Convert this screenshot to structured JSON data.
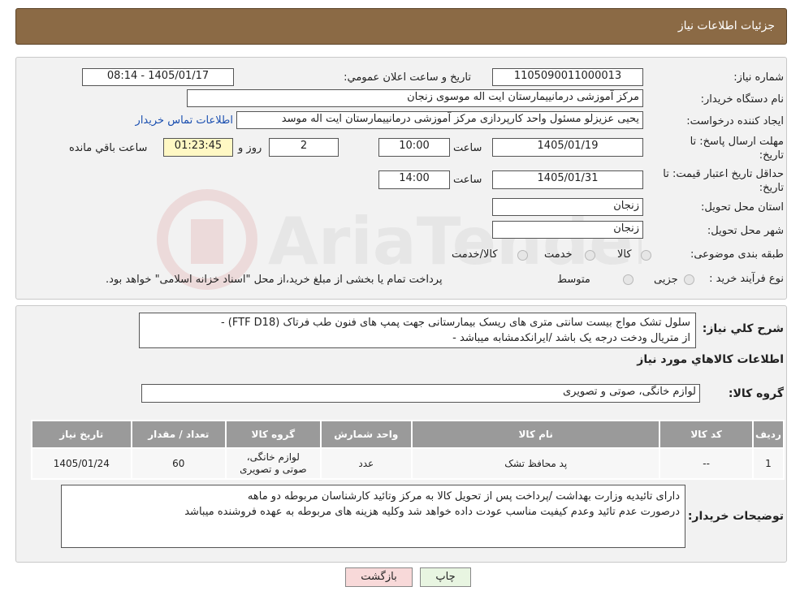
{
  "header": {
    "title": "جزئیات اطلاعات نیاز"
  },
  "form": {
    "need_number_label": "شماره نیاز:",
    "need_number": "1105090011000013",
    "announce_label": "تاریخ و ساعت اعلان عمومي:",
    "announce_value": "1405/01/17 - 08:14",
    "buyer_label": "نام دستگاه خريدار:",
    "buyer_value": "مرکز آموزشی درمانییمارستان ایت اله موسوی زنجان",
    "creator_label": "ايجاد کننده درخواست:",
    "creator_value": "یحیی عزیزلو مسئول واحد کارپردازی مرکز آموزشی درمانییمارستان ایت اله موسد",
    "contact_link": "اطلاعات تماس خريدار",
    "reply_deadline_label": "مهلت ارسال پاسخ: تا تاريخ:",
    "reply_date": "1405/01/19",
    "time_label": "ساعت",
    "reply_time": "10:00",
    "days_value": "2",
    "days_label": "روز و",
    "remaining_time": "01:23:45",
    "remaining_label": "ساعت باقي مانده",
    "validity_label": "حداقل تاريخ اعتبار قيمت: تا تاريخ:",
    "validity_date": "1405/01/31",
    "validity_time": "14:00",
    "province_label": "استان محل تحويل:",
    "province_value": "زنجان",
    "city_label": "شهر محل تحويل:",
    "city_value": "زنجان",
    "category_label": "طبقه بندی موضوعی:",
    "category_options": [
      "کالا",
      "خدمت",
      "کالا/خدمت"
    ],
    "process_label": "نوع فرآيند خريد :",
    "process_options": [
      "جزیی",
      "متوسط"
    ],
    "process_note": "پرداخت تمام یا بخشی از مبلغ خرید،از محل \"اسناد خزانه اسلامی\" خواهد بود."
  },
  "summary": {
    "label": "شرح کلي نياز:",
    "text_line1": "سلول تشک مواج بیست سانتی متری های ریسک بیمارستانی جهت پمپ های فنون طب فرتاک (FTF  D18) -",
    "text_line2": "از متریال  ودخت درجه یک باشد /ایرانکدمشابه میباشد -"
  },
  "goods": {
    "section_title": "اطلاعات کالاهاي مورد نياز",
    "group_label": "گروه کالا:",
    "group_value": "لوازم خانگی، صوتی و تصویری",
    "columns": [
      "رديف",
      "کد کالا",
      "نام کالا",
      "واحد شمارش",
      "گروه کالا",
      "تعداد / مقدار",
      "تاريخ نياز"
    ],
    "rows": [
      {
        "row": "1",
        "code": "--",
        "name": "پد محافظ تشک",
        "unit": "عدد",
        "group_l1": "لوازم خانگی،",
        "group_l2": "صوتی و تصویری",
        "qty": "60",
        "date": "1405/01/24"
      }
    ]
  },
  "buyer_notes": {
    "label": "توضيحات خريدار:",
    "line1": "دارای تائیدیه وزارت بهداشت /پرداخت پس از تحویل کالا به مرکز وتائید کارشناسان مربوطه دو ماهه",
    "line2": "درصورت عدم تائید وعدم کیفیت مناسب عودت داده خواهد شد وکلیه هزینه های مربوطه به عهده فروشنده میباشد"
  },
  "buttons": {
    "print": "چاپ",
    "back": "بازگشت"
  },
  "watermark": {
    "text": "AriaTender.neT"
  },
  "colors": {
    "header_bg": "#8b6a45",
    "back_button_bg": "#f8d9d9",
    "print_button_bg": "#e8f5e1"
  }
}
